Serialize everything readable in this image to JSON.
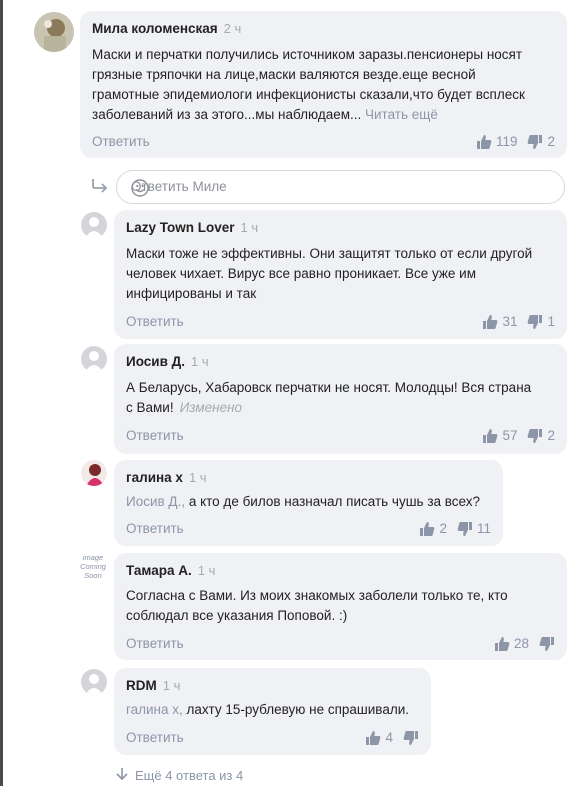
{
  "comments": [
    {
      "author": "Мила коломенская",
      "time": "2 ч",
      "lines": [
        "Маски и перчатки получились источником заразы.пенсионеры носят",
        "грязные тряпочки на лице,маски валяются везде.еще весной",
        "грамотные эпидемиологи инфекционисты сказали,что будет всплеск",
        "заболеваний  из за этого...мы наблюдаем..."
      ],
      "read_more": "Читать ещё",
      "reply_label": "Ответить",
      "likes": "119",
      "dislikes": "2"
    },
    {
      "author": "Lazy Town Lover",
      "time": "1 ч",
      "lines": [
        "Маски тоже не эффективны. Они защитят только от если другой",
        "человек чихает. Вирус все равно проникает. Все уже им",
        "инфицированы и так"
      ],
      "reply_label": "Ответить",
      "likes": "31",
      "dislikes": "1"
    },
    {
      "author": "Иосив Д.",
      "time": "1 ч",
      "lines": [
        "А  Беларусь, Хабаровск перчатки не носят. Молодцы! Вся страна",
        "с Вами!"
      ],
      "edited": "Изменено",
      "reply_label": "Ответить",
      "likes": "57",
      "dislikes": "2"
    },
    {
      "author": "галина х",
      "time": "1 ч",
      "mention": "Иосив Д.,",
      "text": " а кто де билов  назначал писать чушь за всех?",
      "reply_label": "Ответить",
      "likes": "2",
      "dislikes": "11"
    },
    {
      "author": "Тамара А.",
      "time": "1 ч",
      "lines": [
        "Согласна с Вами. Из моих знакомых заболели только те, кто",
        "соблюдал все указания Поповой. :)"
      ],
      "reply_label": "Ответить",
      "likes": "28",
      "dislikes": ""
    },
    {
      "author": "RDM",
      "time": "1 ч",
      "mention": "галина х,",
      "text": " лахту 15-рублевую не спрашивали.",
      "reply_label": "Ответить",
      "likes": "4",
      "dislikes": ""
    }
  ],
  "reply_box": {
    "placeholder": "Ответить Миле"
  },
  "more_replies": "Ещё 4 ответа из 4",
  "avatar_placeholder_text": [
    "image",
    "Coming",
    "Soon"
  ],
  "icons": [
    "thumb-up-icon",
    "thumb-down-icon",
    "reply-arrow-icon",
    "smile-icon",
    "chevron-down-icon"
  ],
  "colors": {
    "bubble": "#f0f1f4",
    "link": "#8c96a8",
    "meta": "#a6a9b0",
    "text": "#222222"
  }
}
